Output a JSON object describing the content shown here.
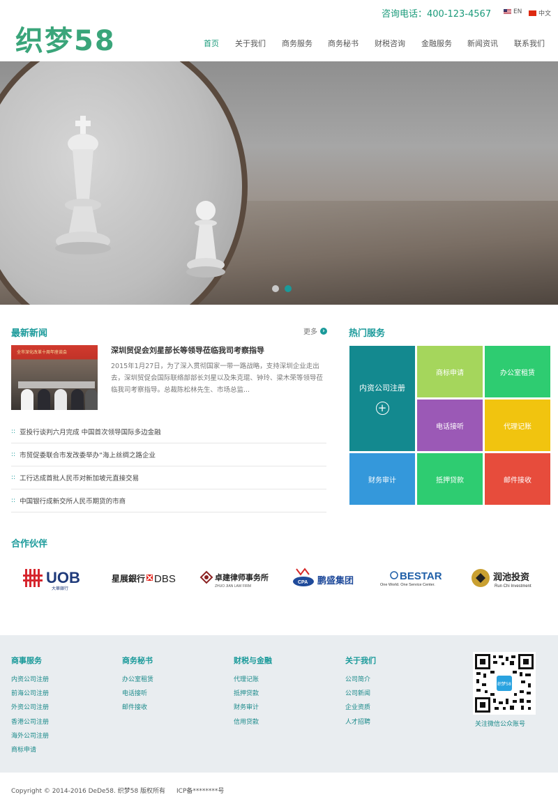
{
  "header": {
    "logo": "织梦58",
    "phone": "咨询电话：400-123-4567",
    "lang_en": "EN",
    "lang_cn": "中文",
    "nav": [
      "首页",
      "关于我们",
      "商务服务",
      "商务秘书",
      "财税咨询",
      "金融服务",
      "新闻资讯",
      "联系我们"
    ],
    "nav_active_index": 0
  },
  "banner": {
    "slide_count": 2,
    "active_slide": 2
  },
  "news": {
    "title": "最新新闻",
    "more": "更多",
    "image_caption": "全市深化改革十周年座谈会",
    "featured_title": "深圳贸促会刘星部长等领导莅临我司考察指导",
    "featured_summary": "2015年1月27日，为了深入贯彻国家一带一路战略，支持深圳企业走出去，深圳贸促会国际联络部部长刘星以及朱克琨、钟玲、梁木荣等领导莅临我司考察指导。总裁陈松林先生、市场总监...",
    "items": [
      "亚投行谈判六月完成 中国首次领导国际多边金融",
      "市贸促委联合市发改委举办“海上丝绸之路企业",
      "工行达成首批人民币对新加坡元直接交易",
      "中国银行成新交所人民币期货的市商"
    ]
  },
  "services": {
    "title": "热门服务",
    "tiles": [
      {
        "label": "内资公司注册",
        "color": "#13898f"
      },
      {
        "label": "商标申请",
        "color": "#a5d65c"
      },
      {
        "label": "办公室租赁",
        "color": "#2ecc71"
      },
      {
        "label": "电话接听",
        "color": "#9b59b6"
      },
      {
        "label": "代理记账",
        "color": "#f1c40f"
      },
      {
        "label": "财务审计",
        "color": "#3498db"
      },
      {
        "label": "抵押贷款",
        "color": "#2ecc71"
      },
      {
        "label": "邮件接收",
        "color": "#e74c3c"
      }
    ]
  },
  "partners": {
    "title": "合作伙伴",
    "logos": [
      {
        "name": "UOB",
        "sub": "大華銀行"
      },
      {
        "name": "DBS",
        "sub": "星展銀行"
      },
      {
        "name": "卓建律师事务所",
        "sub": "ZHUO JIAN LAW FIRM"
      },
      {
        "name": "鹏盛集团",
        "sub": "CPA"
      },
      {
        "name": "BESTAR",
        "sub": "One World. One Service Center."
      },
      {
        "name": "润池投资",
        "sub": "Run Chi Investment"
      }
    ]
  },
  "footer": {
    "columns": [
      {
        "title": "商事服务",
        "links": [
          "内资公司注册",
          "前海公司注册",
          "外资公司注册",
          "香港公司注册",
          "海外公司注册",
          "商标申请"
        ]
      },
      {
        "title": "商务秘书",
        "links": [
          "办公室租赁",
          "电话接听",
          "邮件接收"
        ]
      },
      {
        "title": "财税与金融",
        "links": [
          "代理记账",
          "抵押贷款",
          "财务审计",
          "信用贷款"
        ]
      },
      {
        "title": "关于我们",
        "links": [
          "公司简介",
          "公司新闻",
          "企业资质",
          "人才招聘"
        ]
      }
    ],
    "qr_label": "织梦58",
    "qr_caption": "关注微信公众账号",
    "copyright": "Copyright © 2014-2016 DeDe58. 织梦58 版权所有",
    "icp": "ICP备********号"
  },
  "colors": {
    "accent": "#1a9a9a",
    "logo": "#3aa57a",
    "footer_bg": "#e9edf0"
  }
}
